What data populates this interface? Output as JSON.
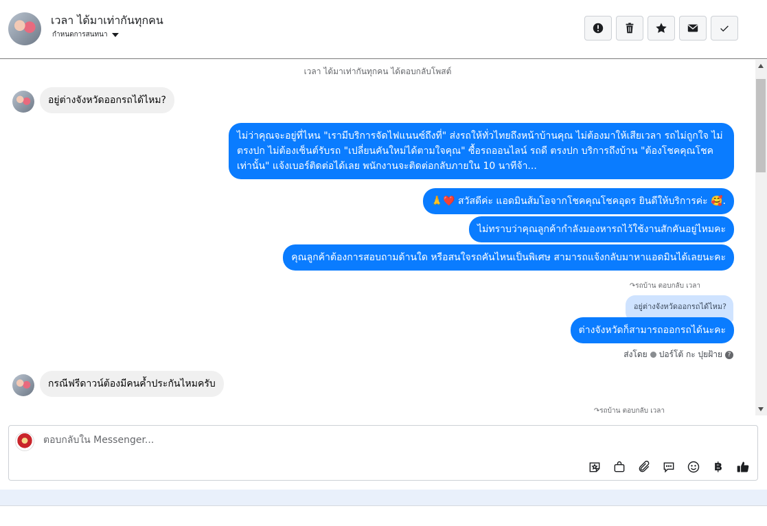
{
  "header": {
    "name": "เวลา ได้มาเท่ากันทุกคน",
    "subtitle": "กำหนดการสนทนา",
    "tools": [
      {
        "icon": "alert-circle-icon"
      },
      {
        "icon": "trash-icon"
      },
      {
        "icon": "star-icon"
      },
      {
        "icon": "envelope-icon"
      },
      {
        "icon": "check-icon"
      }
    ]
  },
  "chat": {
    "system_note": "เวลา ได้มาเท่ากันทุกคน ได้ตอบกลับโพสต์",
    "incoming_1": "อยู่ต่างจังหวัดออกรถได้ไหม?",
    "outgoing_long": "ไม่ว่าคุณจะอยู่ที่ไหน \"เรามีบริการจัดไฟแนนซ์ถึงที่\"  ส่งรถให้ทั่วไทยถึงหน้าบ้านคุณ ไม่ต้องมาให้เสียเวลา รถไม่ถูกใจ ไม่ตรงปก ไม่ต้องเซ็นต์รับรถ \"เปลี่ยนคันใหม่ได้ตามใจคุณ\" ซื้อรถออนไลน์ รถดี ตรงปก บริการถึงบ้าน \"ต้องโชคคุณโชคเท่านั้น\" แจ้งเบอร์ติดต่อได้เลย พนักงานจะติดต่อกลับภายใน 10 นาทีจ้า...",
    "outgoing_2": "🙏❤️ สวัสดีค่ะ แอดมินส้มโอจากโชคคุณโชคอุดร ยินดีให้บริการค่ะ  🥰.",
    "outgoing_3": "ไม่ทราบว่าคุณลูกค้ากำลังมองหารถไว้ใช้งานสักคันอยู่ไหมคะ",
    "outgoing_4": "คุณลูกค้าต้องการสอบถามด้านใด หรือสนใจรถคันไหนเป็นพิเศษ สามารถแจ้งกลับมาหาแอดมินได้เลยนะคะ",
    "reply_meta_1": "รถบ้าน ตอบกลับ เวลา",
    "quoted_text": "อยู่ต่างจังหวัดออกรถได้ไหม?",
    "outgoing_5": "ต่างจังหวัดก็สามารถออกรถได้นะคะ",
    "sent_by_label": "ส่งโดย",
    "sent_by_name": "ปอร์โต้ กะ ปุยฝ้าย",
    "incoming_2": "กรณีฟรีดาวน์ต้องมีคนค้ำประกันไหมครับ",
    "reply_meta_2": "รถบ้าน ตอบกลับ เวลา"
  },
  "composer": {
    "placeholder": "ตอบกลับใน Messenger...",
    "tools": [
      "sticker-icon",
      "gift-icon",
      "paperclip-icon",
      "saved-reply-icon",
      "emoji-icon",
      "baht-icon",
      "thumbs-up-icon"
    ],
    "baht_symbol": "฿"
  }
}
